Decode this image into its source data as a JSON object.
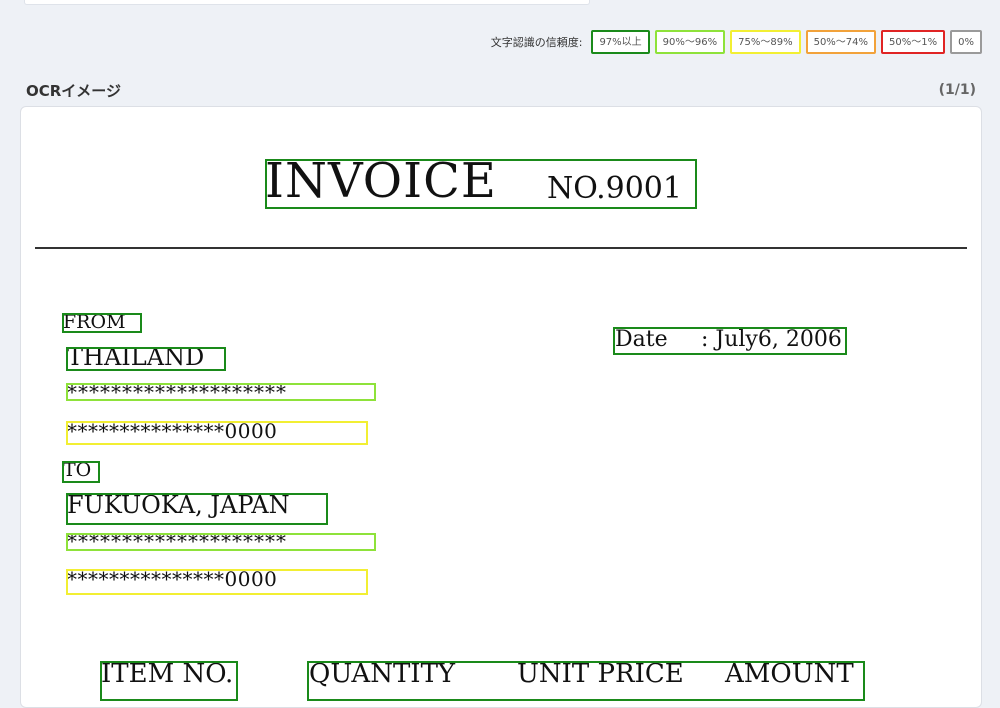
{
  "legend": {
    "label": "文字認識の信頼度:",
    "levels": [
      {
        "text": "97%以上",
        "color": "#1a8a1a"
      },
      {
        "text": "90%〜96%",
        "color": "#8ee23a"
      },
      {
        "text": "75%〜89%",
        "color": "#f2ef33"
      },
      {
        "text": "50%〜74%",
        "color": "#f2a23a"
      },
      {
        "text": "50%〜1%",
        "color": "#e02424"
      },
      {
        "text": "0%",
        "color": "#9a9a9a"
      }
    ]
  },
  "section": {
    "title": "OCRイメージ",
    "page_count": "(1/1)"
  },
  "document": {
    "invoice": "INVOICE",
    "number": "NO.9001",
    "from_label": "FROM",
    "from_country": "THAILAND",
    "from_line1": "********************",
    "from_line2": "***************0000",
    "to_label": "TO",
    "to_location": "FUKUOKA, JAPAN",
    "to_line1": "********************",
    "to_line2": "***************0000",
    "date_label": "Date",
    "date_value": ": July6, 2006",
    "col_item": "ITEM NO.",
    "col_quantity": "QUANTITY",
    "col_unit_price": "UNIT PRICE",
    "col_amount": "AMOUNT"
  }
}
